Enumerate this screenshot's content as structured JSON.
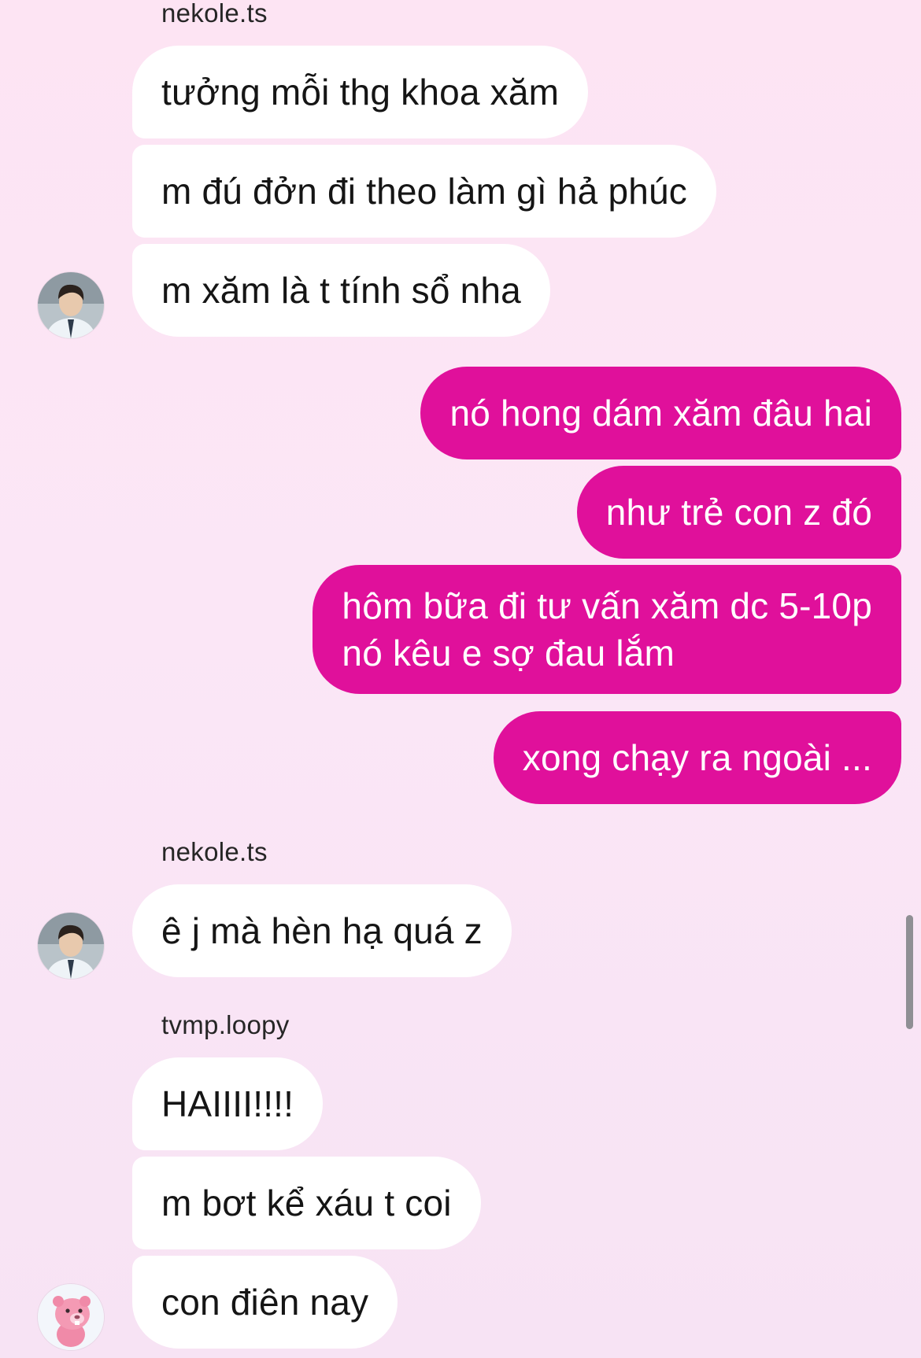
{
  "conversation": {
    "senders": {
      "first": "nekole.ts",
      "second": "nekole.ts",
      "third": "tvmp.loopy"
    },
    "messages": {
      "m1": "tưởng mỗi thg khoa xăm",
      "m2": "m đú đởn đi theo làm gì hả phúc",
      "m3": "m xăm là t tính sổ nha",
      "o1": "nó hong dám xăm đâu hai",
      "o2": "như trẻ con z đó",
      "o3_line1": "hôm bữa đi tư vấn xăm dc 5-10p",
      "o3_line2": "nó kêu e sợ đau lắm",
      "o4": "xong chạy ra ngoài ...",
      "m5": "ê j mà hèn hạ quá z",
      "m6": "HAIIII!!!!",
      "m7": "m bơt kể xáu t coi",
      "m8": "con điên nay"
    }
  },
  "colors": {
    "outgoing_bubble": "#e0109b",
    "incoming_bubble": "#ffffff",
    "background": "#fde4f3"
  },
  "icons": {
    "nekole_avatar": "person-photo-avatar",
    "loopy_avatar": "pink-beaver-avatar"
  }
}
